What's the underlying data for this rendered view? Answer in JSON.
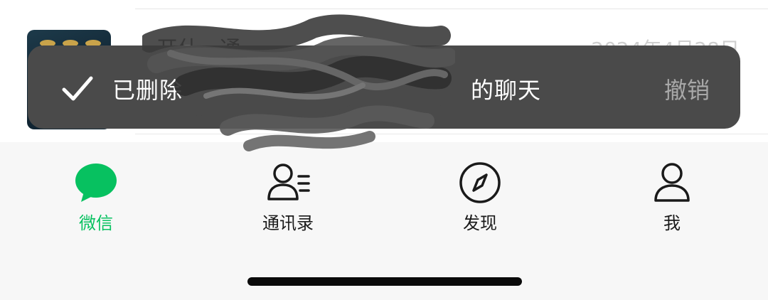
{
  "chat_row": {
    "name": "开什...通...",
    "time": "2024年4月28日"
  },
  "toast": {
    "prefix": "已删除",
    "suffix": "的聊天",
    "undo_label": "撤销",
    "icon": "checkmark-icon"
  },
  "tabbar": {
    "tabs": [
      {
        "label": "微信",
        "icon": "chat-bubble-icon",
        "active": true
      },
      {
        "label": "通讯录",
        "icon": "contacts-icon",
        "active": false
      },
      {
        "label": "发现",
        "icon": "compass-icon",
        "active": false
      },
      {
        "label": "我",
        "icon": "person-icon",
        "active": false
      }
    ]
  },
  "colors": {
    "accent": "#07c160",
    "toast_bg": "#4a4a4a",
    "undo": "#a8a8a8"
  }
}
